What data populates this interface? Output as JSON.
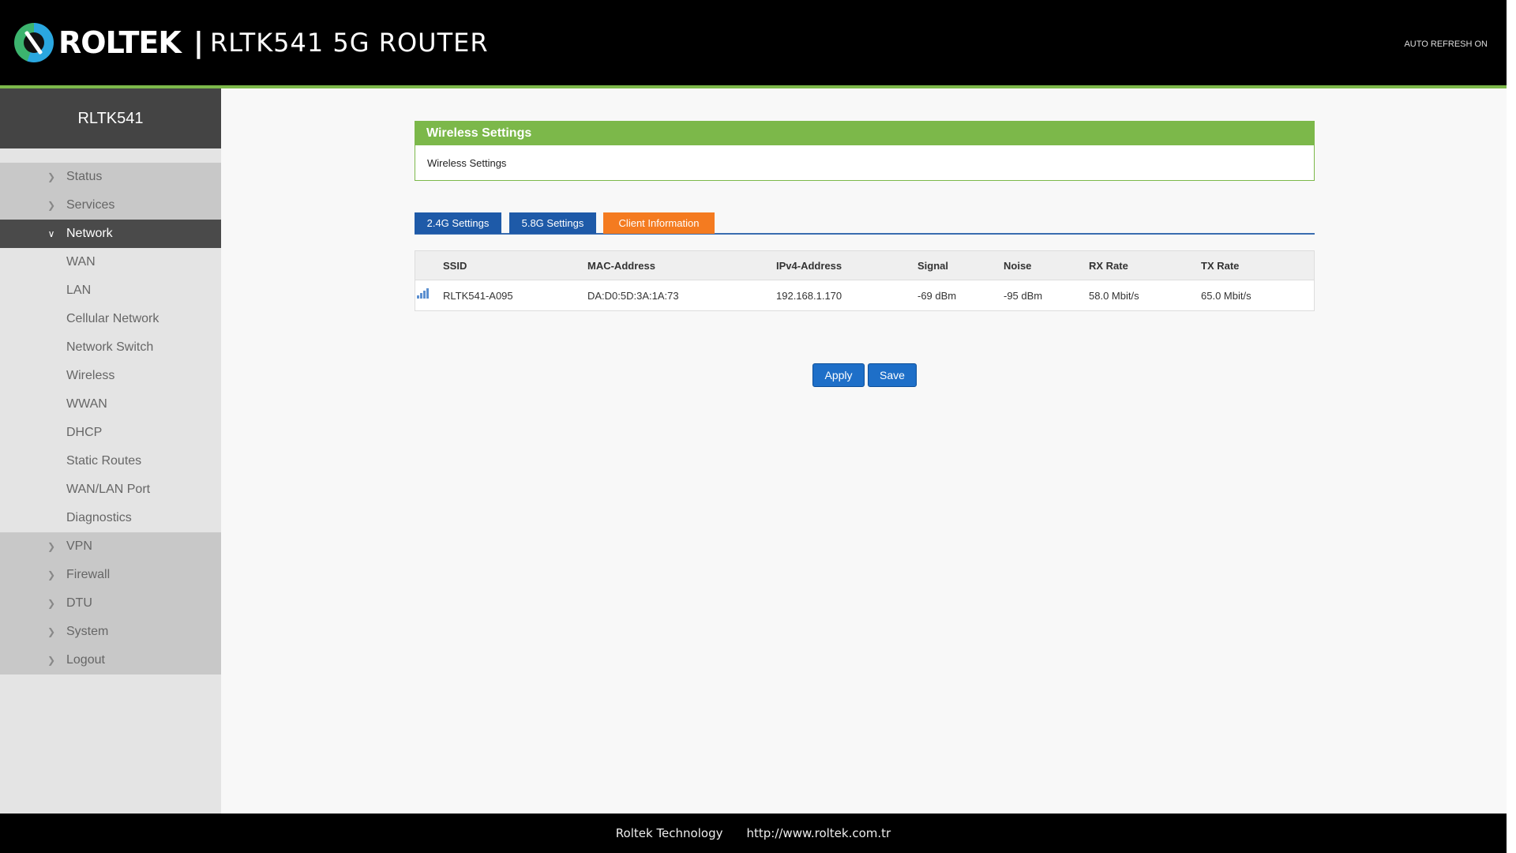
{
  "header": {
    "brand": "ROLTEK",
    "separator": "|",
    "router_title": "RLTK541 5G ROUTER",
    "auto_refresh": "AUTO REFRESH ON"
  },
  "sidebar": {
    "device": "RLTK541",
    "items": [
      {
        "label": "Status",
        "state": "collapsed"
      },
      {
        "label": "Services",
        "state": "collapsed"
      },
      {
        "label": "Network",
        "state": "expanded"
      },
      {
        "label": "WAN"
      },
      {
        "label": "LAN"
      },
      {
        "label": "Cellular Network"
      },
      {
        "label": "Network Switch"
      },
      {
        "label": "Wireless"
      },
      {
        "label": "WWAN"
      },
      {
        "label": "DHCP"
      },
      {
        "label": "Static Routes"
      },
      {
        "label": "WAN/LAN Port"
      },
      {
        "label": "Diagnostics"
      },
      {
        "label": "VPN",
        "state": "collapsed"
      },
      {
        "label": "Firewall",
        "state": "collapsed"
      },
      {
        "label": "DTU",
        "state": "collapsed"
      },
      {
        "label": "System",
        "state": "collapsed"
      },
      {
        "label": "Logout",
        "state": "collapsed"
      }
    ]
  },
  "panel": {
    "title": "Wireless Settings",
    "description": "Wireless Settings"
  },
  "tabs": [
    {
      "label": "2.4G Settings"
    },
    {
      "label": "5.8G Settings"
    },
    {
      "label": "Client Information",
      "active": true
    }
  ],
  "table": {
    "headers": [
      "SSID",
      "MAC-Address",
      "IPv4-Address",
      "Signal",
      "Noise",
      "RX Rate",
      "TX Rate"
    ],
    "rows": [
      [
        "RLTK541-A095",
        "DA:D0:5D:3A:1A:73",
        "192.168.1.170",
        "-69 dBm",
        "-95 dBm",
        "58.0 Mbit/s",
        "65.0 Mbit/s"
      ]
    ]
  },
  "buttons": {
    "apply": "Apply",
    "save": "Save"
  },
  "footer": {
    "company": "Roltek Technology",
    "url": "http://www.roltek.com.tr"
  },
  "colors": {
    "accent_green": "#7cb84a",
    "tab_blue": "#1e5aa8",
    "tab_active_orange": "#f47b20",
    "button_blue": "#1e6fc8"
  }
}
